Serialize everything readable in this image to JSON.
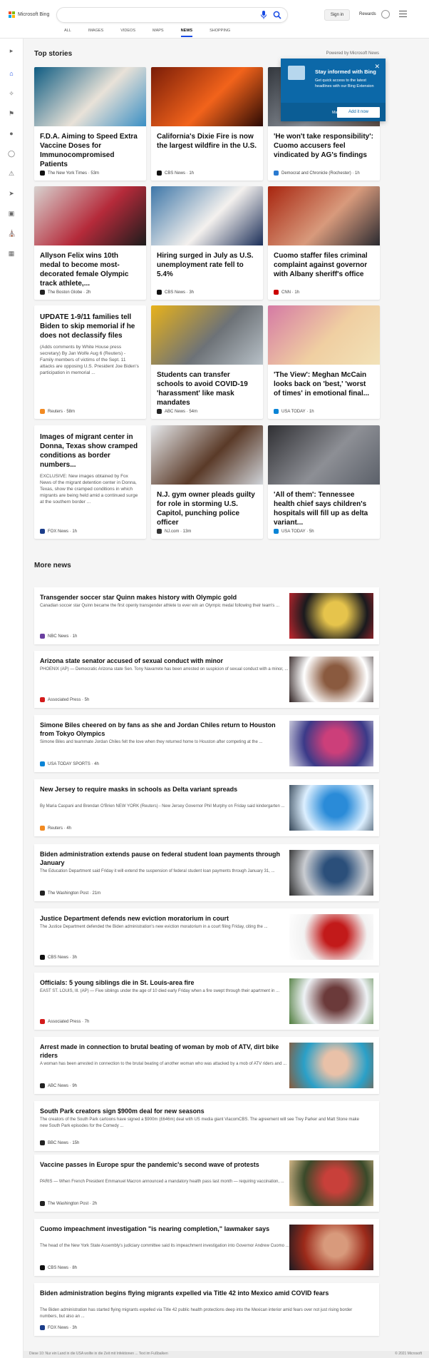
{
  "header": {
    "logo_text": "Microsoft Bing",
    "signin": "Sign in",
    "rewards": "Rewards",
    "tabs": [
      "ALL",
      "IMAGES",
      "VIDEOS",
      "MAPS",
      "NEWS",
      "SHOPPING"
    ],
    "active_tab": "NEWS"
  },
  "top_stories": {
    "title": "Top stories",
    "powered": "Powered by Microsoft News",
    "cards": [
      {
        "title": "F.D.A. Aiming to Speed Extra Vaccine Doses for Immunocompromised Patients",
        "snippet": "",
        "source": "The New York Times · 53m",
        "icon_color": "#111111",
        "image_colors": [
          "#0f5c82",
          "#e9e2d8",
          "#3a8fc4"
        ]
      },
      {
        "title": "California's Dixie Fire is now the largest wildfire in the U.S.",
        "snippet": "",
        "source": "CBS News · 1h",
        "icon_color": "#111111",
        "image_colors": [
          "#7a1d08",
          "#f2631b",
          "#2b0a04"
        ]
      },
      {
        "title": "'He won't take responsibility': Cuomo accusers feel vindicated by AG's findings",
        "snippet": "",
        "source": "Democrat and Chronicle (Rochester) · 1h",
        "icon_color": "#2a7ad0",
        "image_colors": [
          "#32363c",
          "#8a9099",
          "#5a4b43"
        ]
      },
      {
        "title": "Allyson Felix wins 10th medal to become most-decorated female Olympic track athlete,...",
        "snippet": "",
        "source": "The Boston Globe · 2h",
        "icon_color": "#222222",
        "image_colors": [
          "#d8d2cf",
          "#b52a3a",
          "#1c1c1c"
        ]
      },
      {
        "title": "Hiring surged in July as U.S. unemployment rate fell to 5.4%",
        "snippet": "",
        "source": "CBS News · 3h",
        "icon_color": "#111111",
        "image_colors": [
          "#3d76a8",
          "#f4f1ee",
          "#1b2e58"
        ]
      },
      {
        "title": "Cuomo staffer files criminal complaint against governor with Albany sheriff's office",
        "snippet": "",
        "source": "CNN · 1h",
        "icon_color": "#cc0000",
        "image_colors": [
          "#a8250f",
          "#d89a7c",
          "#2a2a30"
        ]
      },
      {
        "title": "UPDATE 1-9/11 families tell Biden to skip memorial if he does not declassify files",
        "snippet": "(Adds comments by White House press secretary) By Jan Wolfe Aug 6 (Reuters) - Family members of victims of the Sept. 11 attacks are opposing U.S. President Joe Biden's participation in memorial ...",
        "source": "Reuters · 58m",
        "icon_color": "#f28a21",
        "image_colors": []
      },
      {
        "title": "Students can transfer schools to avoid COVID-19 'harassment' like mask mandates",
        "snippet": "",
        "source": "ABC News · 54m",
        "icon_color": "#222222",
        "image_colors": [
          "#e8b21a",
          "#6d7277",
          "#b7c0c7"
        ]
      },
      {
        "title": "'The View': Meghan McCain looks back on 'best,' 'worst of times' in emotional final...",
        "snippet": "",
        "source": "USA TODAY · 1h",
        "icon_color": "#0a84d6",
        "image_colors": [
          "#d57aa4",
          "#f0cfa2",
          "#f2e2b8"
        ]
      },
      {
        "title": "Images of migrant center in Donna, Texas show cramped conditions as border numbers...",
        "snippet": "EXCLUSIVE: New images obtained by Fox News of the migrant detention center in Donna, Texas, show the cramped conditions in which migrants are being held amid a continued surge at the southern border ...",
        "source": "FOX News · 1h",
        "icon_color": "#1b3d8a",
        "image_colors": []
      },
      {
        "title": "N.J. gym owner pleads guilty for role in storming U.S. Capitol, punching police officer",
        "snippet": "",
        "source": "NJ.com · 13m",
        "icon_color": "#333333",
        "image_colors": [
          "#e7e9ec",
          "#5a3a28",
          "#cfd3d8"
        ]
      },
      {
        "title": "'All of them': Tennessee health chief says children's hospitals will fill up as delta variant...",
        "snippet": "",
        "source": "USA TODAY · 5h",
        "icon_color": "#0a84d6",
        "image_colors": [
          "#2f2f33",
          "#8d8f95",
          "#5b6069"
        ]
      }
    ]
  },
  "flyout": {
    "title": "Stay informed with Bing",
    "body": "Get quick access to the latest headlines with our Bing Extension",
    "later": "Maybe later",
    "cta": "Add it now"
  },
  "more_news": {
    "title": "More news",
    "items": [
      {
        "title": "Transgender soccer star Quinn makes history with Olympic gold",
        "snippet": "Canadian soccer star Quinn became the first openly transgender athlete to ever win an Olympic medal following their team's ...",
        "source": "NBC News · 1h",
        "icon_color": "#6a3fa0",
        "image_colors": [
          "#1a1a1e",
          "#e6c44c",
          "#c4262e"
        ]
      },
      {
        "title": "Arizona state senator accused of sexual conduct with minor",
        "snippet": "PHOENIX (AP) — Democratic Arizona state Sen. Tony Navarrete has been arrested on suspicion of sexual conduct with a minor, ...",
        "source": "Associated Press · 5h",
        "icon_color": "#d31b1b",
        "image_colors": [
          "#ffffff",
          "#8a5a3f",
          "#2e2020"
        ]
      },
      {
        "title": "Simone Biles cheered on by fans as she and Jordan Chiles return to Houston from Tokyo Olympics",
        "snippet": "Simone Biles and teammate Jordan Chiles felt the love when they returned home to Houston after competing at the ...",
        "source": "USA TODAY SPORTS · 4h",
        "icon_color": "#0a84d6",
        "image_colors": [
          "#3b3a88",
          "#cc3f7a",
          "#d8d8e4"
        ]
      },
      {
        "title": "New Jersey to require masks in schools as Delta variant spreads",
        "snippet": "By Maria Caspani and Brendan O'Brien NEW YORK (Reuters) - New Jersey Governor Phil Murphy on Friday said kindergarten ...",
        "source": "Reuters · 4h",
        "icon_color": "#f28a21",
        "image_colors": [
          "#dcefff",
          "#2a8bd8",
          "#334455"
        ]
      },
      {
        "title": "Biden administration extends pause on federal student loan payments through January",
        "snippet": "The Education Department said Friday it will extend the suspension of federal student loan payments through January 31, ...",
        "source": "The Washington Post · 21m",
        "icon_color": "#222222",
        "image_colors": [
          "#c9ccd1",
          "#2b4f7a",
          "#2a2a2a"
        ]
      },
      {
        "title": "Justice Department defends new eviction moratorium in court",
        "snippet": "The Justice Department defended the Biden administration's new eviction moratorium in a court filing Friday, citing the ...",
        "source": "CBS News · 3h",
        "icon_color": "#111111",
        "image_colors": [
          "#f2f2f2",
          "#c21a1a",
          "#ffffff"
        ]
      },
      {
        "title": "Officials: 5 young siblings die in St. Louis-area fire",
        "snippet": "EAST ST. LOUIS, Ill. (AP) — Five siblings under the age of 10 died early Friday when a fire swept through their apartment in ...",
        "source": "Associated Press · 7h",
        "icon_color": "#d31b1b",
        "image_colors": [
          "#eef2f5",
          "#6b3a3a",
          "#4c7a3a"
        ]
      },
      {
        "title": "Arrest made in connection to brutal beating of woman by mob of ATV, dirt bike riders",
        "snippet": "A woman has been arrested in connection to the brutal beating of another woman who was attacked by a mob of ATV riders and ...",
        "source": "ABC News · 9h",
        "icon_color": "#222222",
        "image_colors": [
          "#2aa0c8",
          "#e9c1a8",
          "#8a5a3a"
        ]
      },
      {
        "title": "South Park creators sign $900m deal for new seasons",
        "snippet": "The creators of the South Park cartoons have signed a $900m (£646m) deal with US media giant ViacomCBS. The agreement will see Trey Parker and Matt Stone make new South Park episodes for the Comedy ...",
        "source": "BBC News · 15h",
        "icon_color": "#222222",
        "image_colors": []
      },
      {
        "title": "Vaccine passes in Europe spur the pandemic's second wave of protests",
        "snippet": "PARIS — When French President Emmanuel Macron announced a mandatory health pass last month — requiring vaccination, ...",
        "source": "The Washington Post · 2h",
        "icon_color": "#222222",
        "image_colors": [
          "#3a4a2a",
          "#c8403a",
          "#e0c090"
        ]
      },
      {
        "title": "Cuomo impeachment investigation \"is nearing completion,\" lawmaker says",
        "snippet": "The head of the New York State Assembly's judiciary committee said its impeachment investigation into Governor Andrew Cuomo ...",
        "source": "CBS News · 8h",
        "icon_color": "#111111",
        "image_colors": [
          "#9c2a1a",
          "#d89a7c",
          "#1b1b22"
        ]
      },
      {
        "title": "Biden administration begins flying migrants expelled via Title 42 into Mexico amid COVID fears",
        "snippet": "The Biden administration has started flying migrants expelled via Title 42 public health protections deep into the Mexican interior amid fears over not just rising border numbers, but also an ...",
        "source": "FOX News · 3h",
        "icon_color": "#1b3d8a",
        "image_colors": []
      }
    ]
  },
  "footer": {
    "left": "Diese 10: Nur ein Land in die USA wollte in die Zeit mit Infektionen ... Text im Fußbalken",
    "right": "© 2021 Microsoft"
  }
}
